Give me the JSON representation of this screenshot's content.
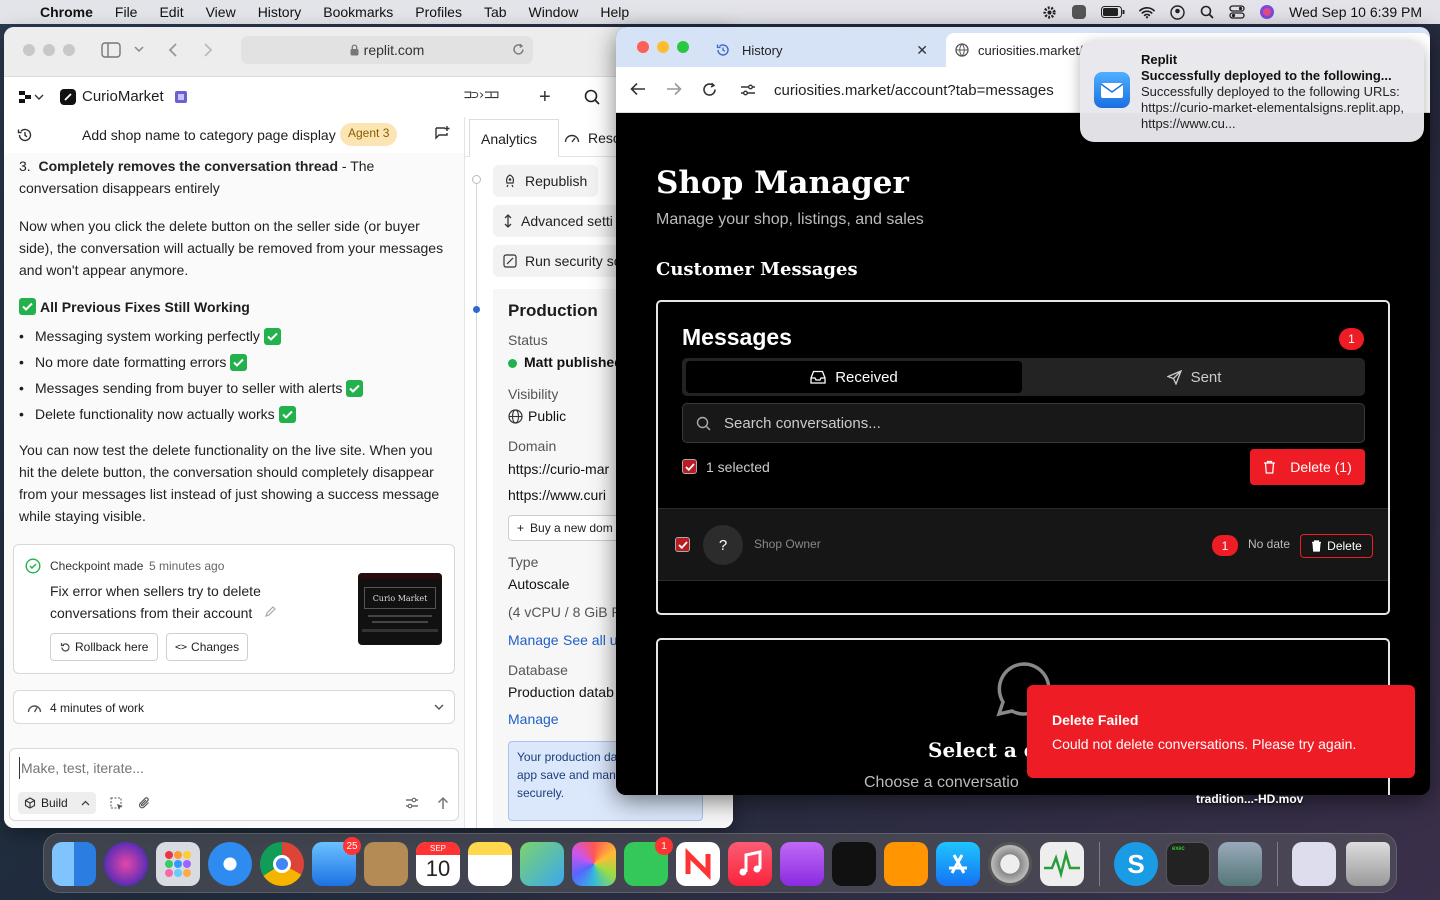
{
  "menubar": {
    "items": [
      "Chrome",
      "File",
      "Edit",
      "View",
      "History",
      "Bookmarks",
      "Profiles",
      "Tab",
      "Window",
      "Help"
    ],
    "datetime": "Wed Sep 10  6:39 PM"
  },
  "left_window": {
    "url": "replit.com",
    "project_name": "CurioMarket",
    "thread_title": "Add shop name to category page display",
    "agent_badge": "Agent 3",
    "chat": {
      "item3_bold": "Completely removes the conversation thread",
      "item3_rest": " - The conversation disappears entirely",
      "item3_num": "3.",
      "para1": "Now when you click the delete button on the seller side (or buyer side), the conversation will actually be removed from your messages and won't appear anymore.",
      "fixes_heading": "All Previous Fixes Still Working",
      "fixes": [
        "Messaging system working perfectly",
        "No more date formatting errors",
        "Messages sending from buyer to seller with alerts",
        "Delete functionality now actually works"
      ],
      "para2": "You can now test the delete functionality on the live site. When you hit the delete button, the conversation should completely disappear from your messages list instead of just showing a success message while staying visible.",
      "checkpoint_label": "Checkpoint made",
      "checkpoint_time": "5 minutes ago",
      "checkpoint_desc": "Fix error when sellers try to delete conversations from their account",
      "rollback": "Rollback here",
      "changes": "Changes",
      "thumb_title": "Curio Market",
      "work_summary": "4 minutes of work",
      "input_placeholder": "Make, test, iterate...",
      "build_mode": "Build"
    },
    "deploy": {
      "tab_analytics": "Analytics",
      "tab_resources": "Reso",
      "republish": "Republish",
      "advanced": "Advanced setti",
      "security": "Run security sc",
      "production": "Production",
      "status_label": "Status",
      "status_value": "Matt published",
      "visibility_label": "Visibility",
      "visibility_value": "Public",
      "domain_label": "Domain",
      "domain1": "https://curio-mar",
      "domain2": "https://www.curi",
      "buy_domain": "Buy a new dom",
      "type_label": "Type",
      "type_value": "Autoscale",
      "type_spec": "(4 vCPU / 8 GiB R",
      "manage": "Manage",
      "see_all": "See all u",
      "database_label": "Database",
      "database_value": "Production datab",
      "manage2": "Manage",
      "info": "Your production da is ready! Your app save and manage l data securely."
    }
  },
  "right_window": {
    "tab1": "History",
    "tab2": "curiosities.market/",
    "url": "curiosities.market/account?tab=messages",
    "shop_title": "Shop Manager",
    "shop_subtitle": "Manage your shop, listings, and sales",
    "section_title": "Customer Messages",
    "messages_title": "Messages",
    "messages_count": "1",
    "tab_received": "Received",
    "tab_sent": "Sent",
    "search_placeholder": "Search conversations...",
    "selected_text": "1 selected",
    "delete_selected": "Delete (1)",
    "row": {
      "avatar": "?",
      "name": "Shop Owner",
      "badge": "1",
      "date": "No date",
      "delete": "Delete"
    },
    "empty_title": "Select a con",
    "empty_sub": "Choose a conversatio"
  },
  "notification": {
    "app": "Replit",
    "title": "Successfully deployed to the following...",
    "body": "Successfully deployed to the following URLs: https://curio-market-elementalsigns.replit.app, https://www.cu..."
  },
  "toast": {
    "title": "Delete Failed",
    "body": "Could not delete conversations. Please try again."
  },
  "desktop_file": "tradition...-HD.mov",
  "dock": {
    "mail_badge": "25",
    "facetime_badge": "1",
    "calendar_month": "SEP",
    "calendar_day": "10",
    "terminal_label": "exec"
  },
  "colors": {
    "accent_red": "#ee1c24",
    "link_blue": "#1f5fc7",
    "success_green": "#22b14c"
  }
}
